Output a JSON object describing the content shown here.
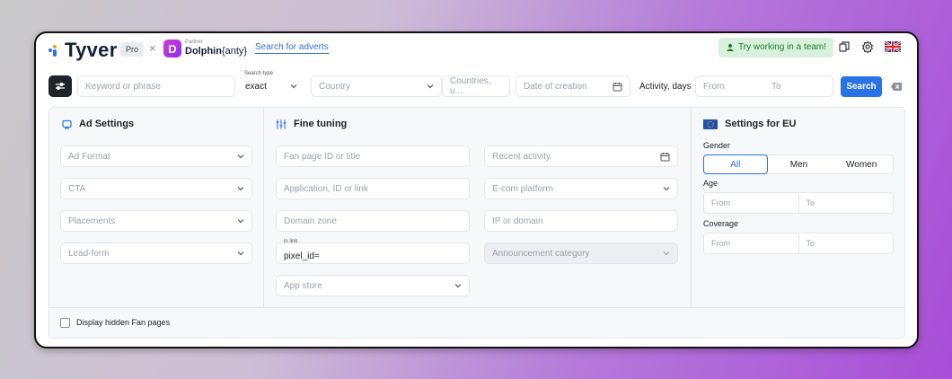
{
  "header": {
    "brand": "Tyver",
    "plan_badge": "Pro",
    "times": "×",
    "partner_label": "Partner",
    "partner_name_bold": "Dolphin",
    "partner_name_rest": "{anty}",
    "nav_link": "Search for adverts",
    "team_button": "Try working in a team!",
    "icons": [
      "copy-icon",
      "gear-icon",
      "uk-flag-icon"
    ]
  },
  "search_bar": {
    "keyword_placeholder": "Keyword or phrase",
    "search_type_label": "Search type",
    "search_type_value": "exact",
    "country_placeholder": "Country",
    "countries_placeholder": "Countries, u...",
    "date_placeholder": "Date of creation",
    "activity_label": "Activity, days",
    "from_placeholder": "From",
    "to_placeholder": "To",
    "search_button": "Search"
  },
  "ad_settings": {
    "title": "Ad Settings",
    "fields": [
      "Ad Format",
      "CTA",
      "Placements",
      "Lead-form"
    ]
  },
  "fine_tuning": {
    "title": "Fine tuning",
    "fan_page": "Fan page ID or title",
    "application": "Application, ID or link",
    "domain_zone": "Domain zone",
    "in_link_label": "in link",
    "in_link_value": "pixel_id=",
    "app_store": "App store",
    "recent_activity": "Recent activity",
    "ecom_platform": "E-com platform",
    "ip_domain": "IP or domain",
    "announcement_category": "Announcement category"
  },
  "eu_settings": {
    "title": "Settings for EU",
    "gender_label": "Gender",
    "gender_options": [
      "All",
      "Men",
      "Women"
    ],
    "age_label": "Age",
    "age_from": "From",
    "age_to": "To",
    "coverage_label": "Coverage",
    "coverage_from": "From",
    "coverage_to": "To"
  },
  "footer": {
    "checkbox_label": "Display hidden Fan pages"
  },
  "colors": {
    "accent": "#2a73e6",
    "team_bg": "#d9f1dc",
    "team_text": "#1e7a2f",
    "dark_button": "#1f242b"
  }
}
